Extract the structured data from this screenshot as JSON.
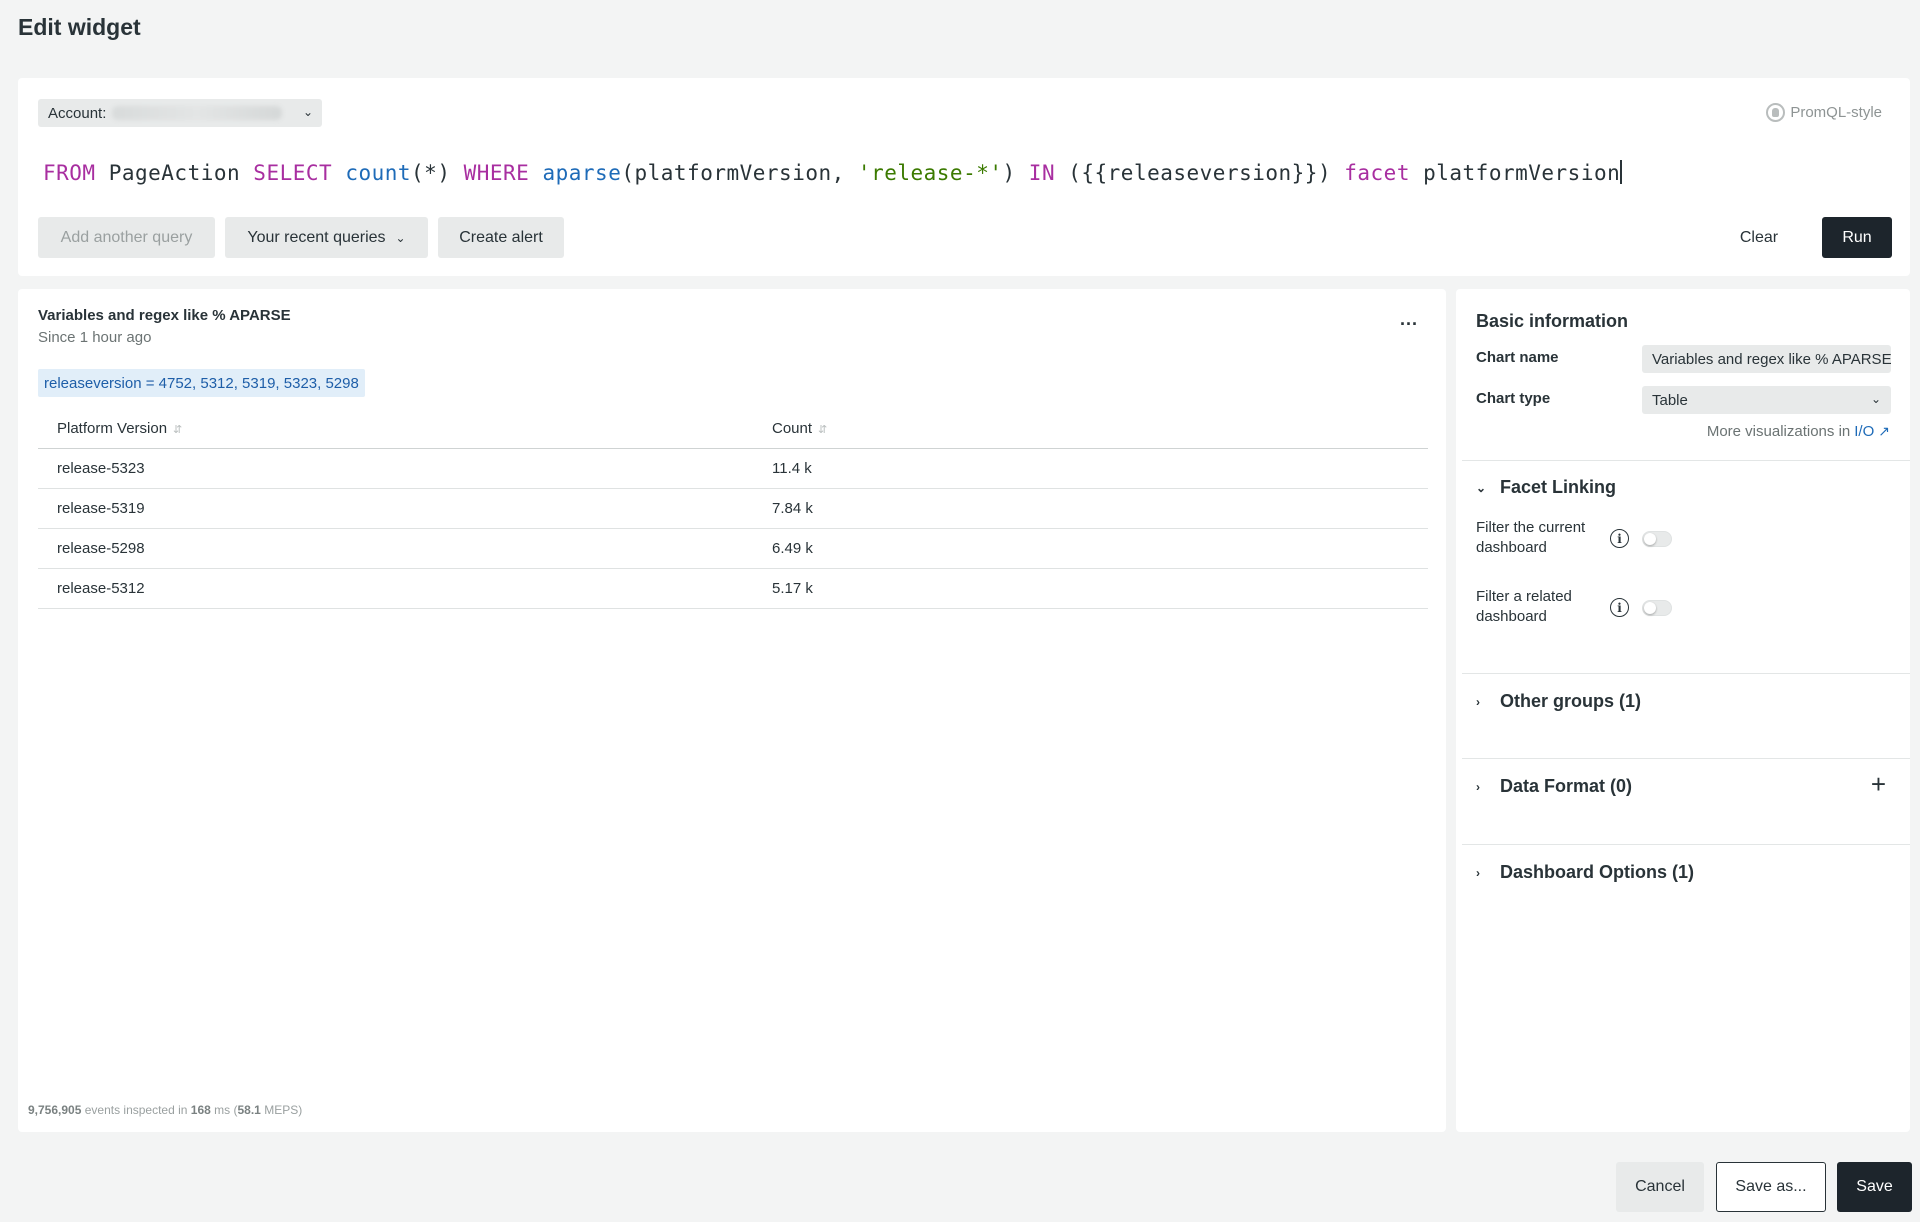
{
  "page": {
    "title": "Edit widget"
  },
  "query": {
    "account_label": "Account:",
    "promql_label": "PromQL-style",
    "tokens": [
      {
        "t": "FROM",
        "k": "kw"
      },
      {
        "t": " PageAction ",
        "k": ""
      },
      {
        "t": "SELECT",
        "k": "kw"
      },
      {
        "t": " ",
        "k": ""
      },
      {
        "t": "count",
        "k": "fn"
      },
      {
        "t": "(*) ",
        "k": ""
      },
      {
        "t": "WHERE",
        "k": "kw"
      },
      {
        "t": " ",
        "k": ""
      },
      {
        "t": "aparse",
        "k": "fn"
      },
      {
        "t": "(platformVersion, ",
        "k": ""
      },
      {
        "t": "'release-*'",
        "k": "str"
      },
      {
        "t": ") ",
        "k": ""
      },
      {
        "t": "IN",
        "k": "kw"
      },
      {
        "t": " ({{releaseversion}}) ",
        "k": ""
      },
      {
        "t": "facet",
        "k": "kw"
      },
      {
        "t": " platformVersion",
        "k": ""
      }
    ],
    "buttons": {
      "add": "Add another query",
      "recent": "Your recent queries",
      "alert": "Create alert",
      "clear": "Clear",
      "run": "Run"
    }
  },
  "result": {
    "title": "Variables and regex like % APARSE",
    "subtitle": "Since 1 hour ago",
    "more": "...",
    "variable_chip": "releaseversion = 4752, 5312, 5319, 5323, 5298",
    "columns": [
      "Platform Version",
      "Count"
    ],
    "rows": [
      [
        "release-5323",
        "11.4 k"
      ],
      [
        "release-5319",
        "7.84 k"
      ],
      [
        "release-5298",
        "6.49 k"
      ],
      [
        "release-5312",
        "5.17 k"
      ]
    ],
    "stats": {
      "events": "9,756,905",
      "mid1": " events inspected in ",
      "ms": "168",
      "mid2": " ms (",
      "meps": "58.1",
      "end": " MEPS)"
    }
  },
  "side": {
    "basic_title": "Basic information",
    "chart_name_label": "Chart name",
    "chart_name_value": "Variables and regex like % APARSE",
    "chart_type_label": "Chart type",
    "chart_type_value": "Table",
    "more_viz_text": "More visualizations in",
    "more_viz_link": "I/O",
    "facet_linking": "Facet Linking",
    "filter_current": "Filter the current dashboard",
    "filter_related": "Filter a related dashboard",
    "other_groups": "Other groups (1)",
    "data_format": "Data Format (0)",
    "dashboard_options": "Dashboard Options (1)"
  },
  "footer": {
    "cancel": "Cancel",
    "save_as": "Save as...",
    "save": "Save"
  }
}
